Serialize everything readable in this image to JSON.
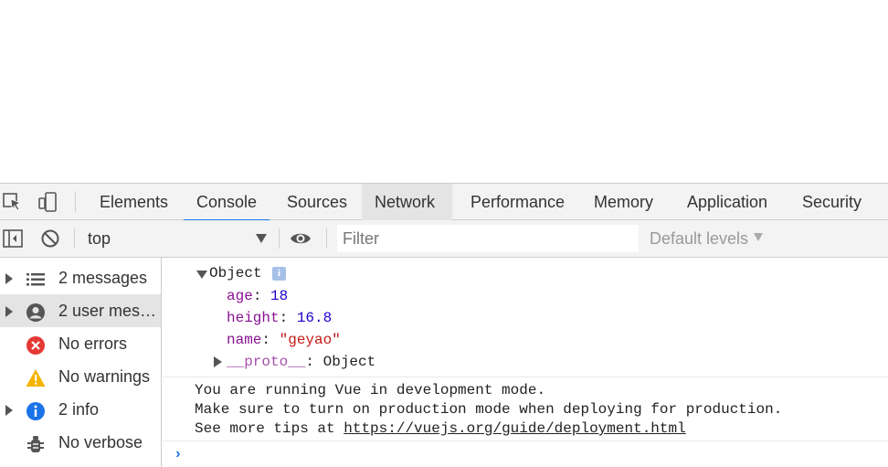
{
  "tabs": {
    "elements": "Elements",
    "console": "Console",
    "sources": "Sources",
    "network": "Network",
    "performance": "Performance",
    "memory": "Memory",
    "application": "Application",
    "security": "Security"
  },
  "toolbar": {
    "context": "top",
    "filter_placeholder": "Filter",
    "levels": "Default levels"
  },
  "sidebar": {
    "items": [
      {
        "label": "2 messages",
        "icon": "list-icon"
      },
      {
        "label": "2 user mess...",
        "icon": "user-icon"
      },
      {
        "label": "No errors",
        "icon": "error-icon"
      },
      {
        "label": "No warnings",
        "icon": "warning-icon"
      },
      {
        "label": "2 info",
        "icon": "info-icon"
      },
      {
        "label": "No verbose",
        "icon": "bug-icon"
      }
    ]
  },
  "console": {
    "object": {
      "label": "Object",
      "badge": "i",
      "props": [
        {
          "key": "age",
          "value": "18",
          "type": "number"
        },
        {
          "key": "height",
          "value": "16.8",
          "type": "number"
        },
        {
          "key": "name",
          "value": "\"geyao\"",
          "type": "string"
        }
      ],
      "proto_key": "__proto__",
      "proto_value": "Object"
    },
    "vue_message": {
      "line1": "You are running Vue in development mode.",
      "line2": "Make sure to turn on production mode when deploying for production.",
      "line3_prefix": "See more tips at ",
      "line3_link": "https://vuejs.org/guide/deployment.html"
    },
    "prompt": "›"
  },
  "colors": {
    "accent": "#1a73e8",
    "error": "#d93025",
    "warning": "#f5b400",
    "info": "#1a73e8"
  }
}
